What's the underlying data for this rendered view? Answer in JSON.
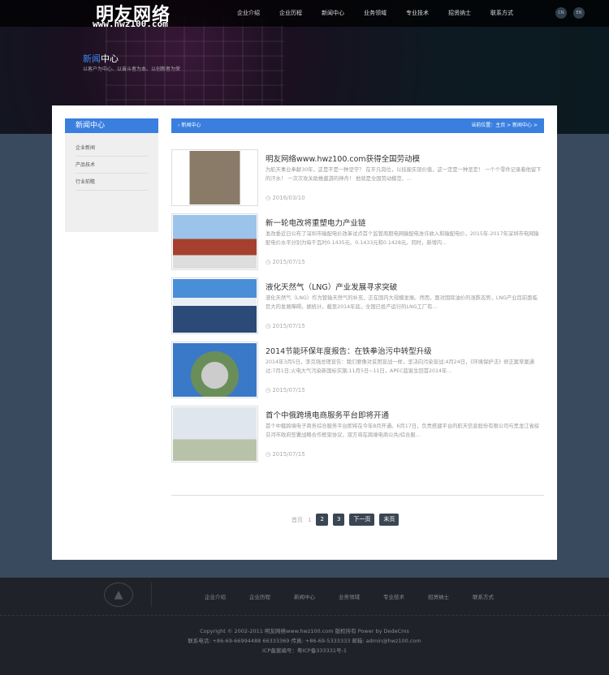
{
  "header": {
    "logo": "明友网络",
    "logo_url": "www.hwz100.com",
    "nav": [
      "企业介绍",
      "企业历程",
      "新闻中心",
      "业务领域",
      "专业技术",
      "招贤纳士",
      "联系方式"
    ],
    "lang": [
      "CN",
      "EN"
    ],
    "section_title_hl": "新闻",
    "section_title_rest": "中心",
    "section_sub": "以客户为中心、以奋斗者为本、以创新者为荣"
  },
  "sidebar": {
    "title": "新闻中心",
    "items": [
      "企业新闻",
      "产品技术",
      "行业前瞻"
    ]
  },
  "crumb": {
    "title": "新闻中心",
    "location": "当前位置：主页 > 新闻中心 >"
  },
  "news": [
    {
      "title": "明友网络www.hwz100.com获得全国劳动模",
      "desc": "为航天事业奉献30年，这是不是一种坚守？ 在平凡岗位，以技能实现价值，这一定是一种坚定！ 一个个零件记录着他留下的汗水！ 一次次攻关助推遨游的神舟！ 他就是全国劳动模范、...",
      "date": "2016/03/10"
    },
    {
      "title": "新一轮电改将重塑电力产业链",
      "desc": "发改委近日公布了深圳市输配电价改革试点首个监管周期电网输配电准许收入和输配电价，2015年-2017年深圳市电网输配电价水平分别为每千瓦时0.1435元、0.1433元和0.1428元。同时，新增内...",
      "date": "2015/07/15"
    },
    {
      "title": "液化天然气（LNG）产业发展寻求突破",
      "desc": "液化天然气（LNG）作为管输天然气的补充，正在国内大规模发展。然而，面对国际油价的涨跌态势，LNG产业目前面临巨大的发展障碍。据统计，截至2014年底，全国已投产运行的LNG工厂有...",
      "date": "2015/07/15"
    },
    {
      "title": "2014节能环保年度报告：在铁拳治污中转型升级",
      "desc": "2014年3月5日，李克强总理宣告：我们要像对贫困宣战一样，坚决向污染宣战;4月24日，《环境保护法》修正案草案通过;7月1日;火电大气污染新国标实施;11月5日~11日，APEC蓝诞生回首2014年...",
      "date": "2015/07/15"
    },
    {
      "title": "首个中俄跨境电商服务平台即将开通",
      "desc": "首个中俄跨境电子商务综合服务平台即将在今年8月开通。6月17日，负责搭建平台的航天信息股份有限公司与黑龙江省绥芬河市政府签署战略合作框架协议，双方将在跨境电商公共/综合服...",
      "date": "2015/07/15"
    }
  ],
  "pager": {
    "first": "首页",
    "current": "1",
    "p2": "2",
    "p3": "3",
    "next": "下一页",
    "last": "末页"
  },
  "footer": {
    "nav": [
      "企业介绍",
      "企业历程",
      "新闻中心",
      "业务领域",
      "专业技术",
      "招贤纳士",
      "联系方式"
    ],
    "copyright": "Copyright © 2002-2011 明友网络www.hwz100.com 版权所有   Power by DedeCms",
    "contact": "联系电话: +86-69-66994488    66333369 传真: +86-69-5333333 邮箱: admin@hwz100.com",
    "icp": "ICP备案编号：粤ICP备333331号-1"
  }
}
